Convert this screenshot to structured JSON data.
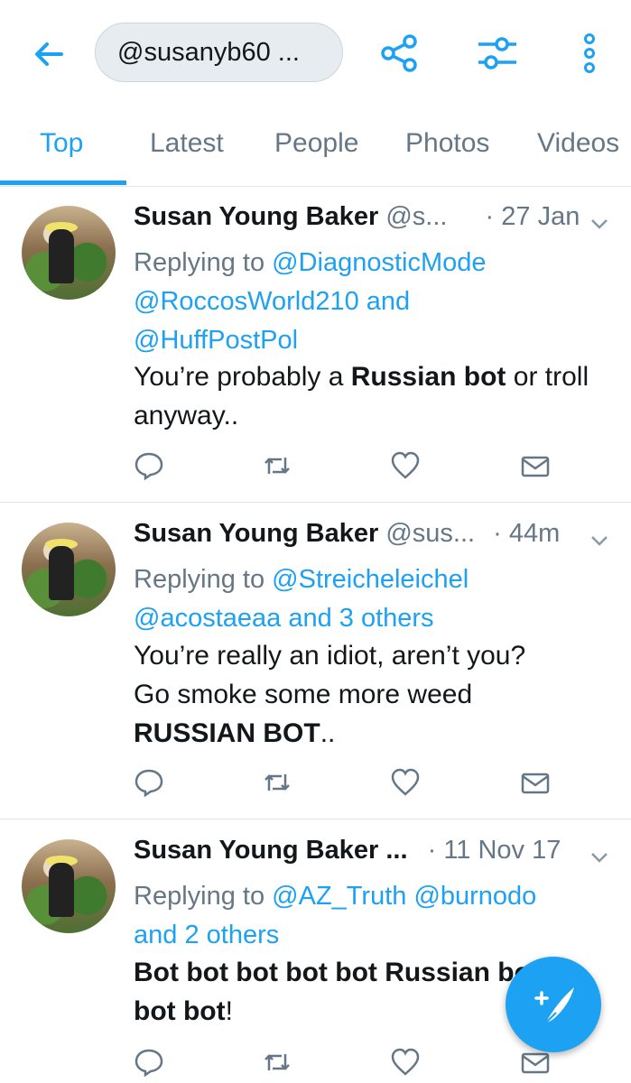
{
  "header": {
    "search_value": "@susanyb60 ..."
  },
  "tabs": [
    {
      "label": "Top",
      "active": true
    },
    {
      "label": "Latest",
      "active": false
    },
    {
      "label": "People",
      "active": false
    },
    {
      "label": "Photos",
      "active": false
    },
    {
      "label": "Videos",
      "active": false
    }
  ],
  "tweets": [
    {
      "name": "Susan Young Baker",
      "handle": "@s...",
      "dot": "·",
      "time": "27 Jan",
      "reply_prefix": "Replying to",
      "mentions_1": "@DiagnosticMode",
      "mentions_2": "@RoccosWorld210 and",
      "mentions_3": "@HuffPostPol",
      "body_1a": "You’re probably a ",
      "body_1b": "Russian bot",
      "body_1c": " or troll",
      "body_2": "anyway.."
    },
    {
      "name": "Susan Young Baker",
      "handle": "@sus...",
      "dot": "·",
      "time": "44m",
      "reply_prefix": "Replying to",
      "mentions_1": "@Streicheleichel",
      "mentions_2": "@acostaeaa and 3 others",
      "body_1": "You’re really an idiot, aren’t you?",
      "body_2": "Go smoke some more weed",
      "body_3a": "RUSSIAN BOT",
      "body_3b": ".."
    },
    {
      "name": "Susan Young Baker ...",
      "dot": "·",
      "time": "11 Nov 17",
      "reply_prefix": "Replying to",
      "mentions_1": "@AZ_Truth @burnodo",
      "mentions_2": "and 2 others",
      "body_1": "Bot bot bot bot bot Russian bo",
      "body_2a": "bot bot",
      "body_2b": "!"
    }
  ],
  "colors": {
    "accent": "#1da1f2",
    "muted": "#657786",
    "text": "#14171a"
  },
  "icons": [
    "back-arrow-icon",
    "share-icon",
    "filter-icon",
    "more-icon",
    "reply-icon",
    "retweet-icon",
    "like-icon",
    "message-icon",
    "compose-icon",
    "chevron-down-icon"
  ]
}
